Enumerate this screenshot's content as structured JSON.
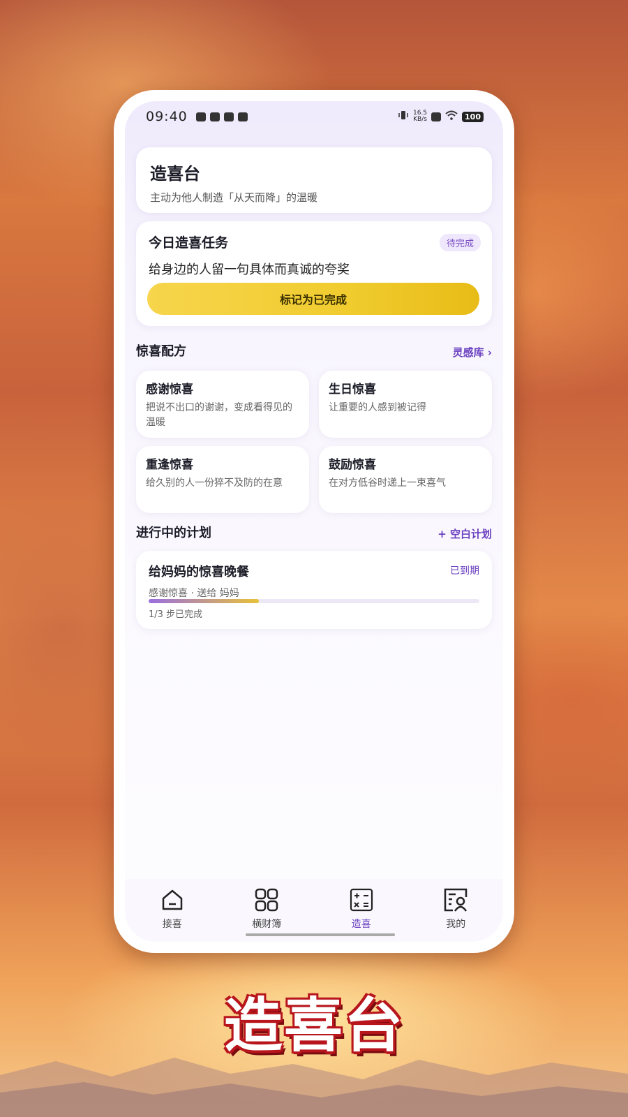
{
  "status_bar": {
    "time": "09:40",
    "speed_value": "16.5",
    "speed_unit": "KB/s",
    "battery": "100"
  },
  "header": {
    "title": "造喜台",
    "subtitle": "主动为他人制造「从天而降」的温暖"
  },
  "daily_task": {
    "title": "今日造喜任务",
    "badge": "待完成",
    "text": "给身边的人留一句具体而真诚的夸奖",
    "button_label": "标记为已完成"
  },
  "recipes": {
    "title": "惊喜配方",
    "link": "灵感库 ›",
    "items": [
      {
        "title": "感谢惊喜",
        "desc": "把说不出口的谢谢，变成看得见的温暖"
      },
      {
        "title": "生日惊喜",
        "desc": "让重要的人感到被记得"
      },
      {
        "title": "重逢惊喜",
        "desc": "给久别的人一份猝不及防的在意"
      },
      {
        "title": "鼓励惊喜",
        "desc": "在对方低谷时递上一束喜气"
      }
    ]
  },
  "plans": {
    "title": "进行中的计划",
    "link": "+ 空白计划",
    "items": [
      {
        "title": "给妈妈的惊喜晚餐",
        "status": "已到期",
        "meta": "感谢惊喜 · 送给 妈妈",
        "progress_text": "1/3 步已完成",
        "progress": 0.333
      }
    ]
  },
  "tabs": [
    {
      "label": "接喜",
      "icon": "home-icon",
      "active": false
    },
    {
      "label": "横财簿",
      "icon": "grid-icon",
      "active": false
    },
    {
      "label": "造喜",
      "icon": "calculator-icon",
      "active": true
    },
    {
      "label": "我的",
      "icon": "profile-card-icon",
      "active": false
    }
  ],
  "brand_caption": "造喜台",
  "colors": {
    "accent": "#6a3fc0",
    "button_yellow": "#f0cc2f",
    "brand_red": "#b8151c"
  }
}
